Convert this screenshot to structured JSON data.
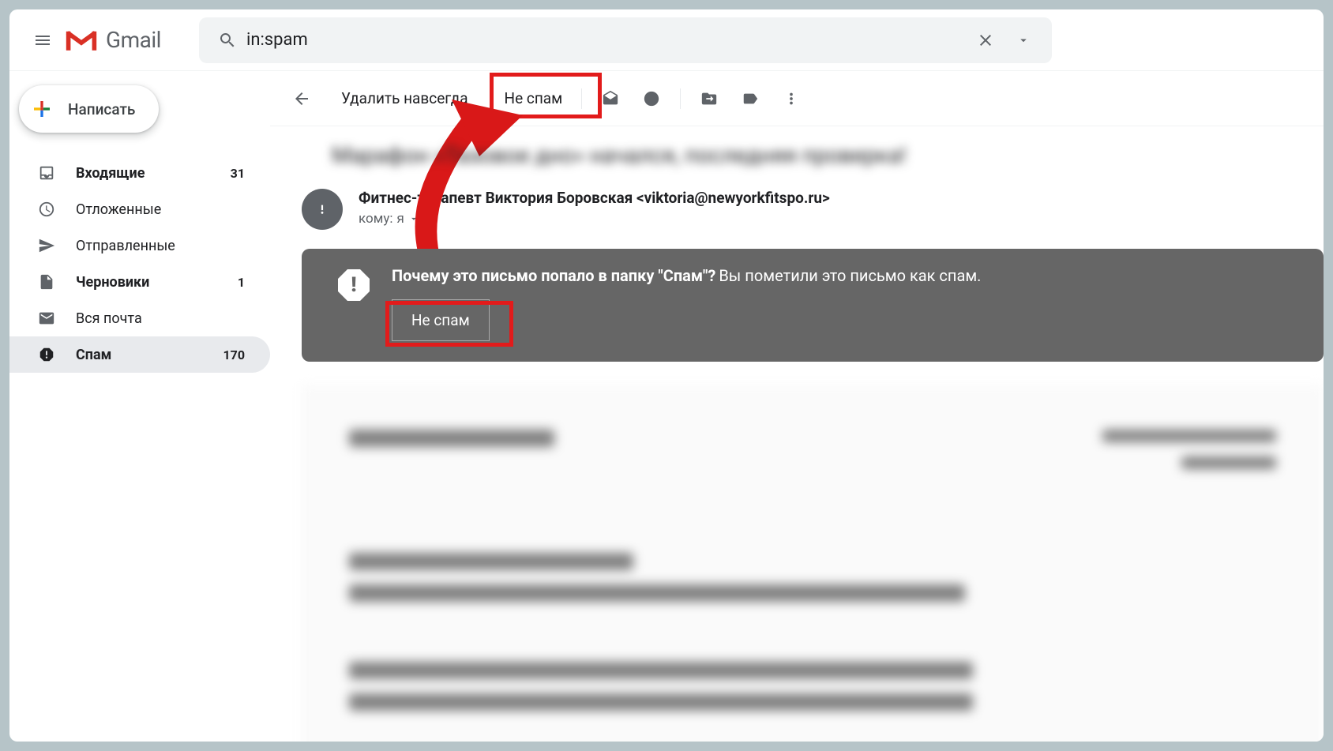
{
  "header": {
    "brand": "Gmail",
    "search_value": "in:spam"
  },
  "sidebar": {
    "compose_label": "Написать",
    "items": [
      {
        "label": "Входящие",
        "count": "31",
        "bold": true,
        "active": false,
        "icon": "inbox"
      },
      {
        "label": "Отложенные",
        "count": "",
        "bold": false,
        "active": false,
        "icon": "snooze"
      },
      {
        "label": "Отправленные",
        "count": "",
        "bold": false,
        "active": false,
        "icon": "sent"
      },
      {
        "label": "Черновики",
        "count": "1",
        "bold": true,
        "active": false,
        "icon": "drafts"
      },
      {
        "label": "Вся почта",
        "count": "",
        "bold": false,
        "active": false,
        "icon": "allmail"
      },
      {
        "label": "Спам",
        "count": "170",
        "bold": true,
        "active": true,
        "icon": "spam"
      }
    ]
  },
  "toolbar": {
    "delete_forever": "Удалить навсегда",
    "not_spam": "Не спам"
  },
  "message": {
    "subject_blurred": "Марафон «Тазовое дно» начался, последняя проверка!",
    "sender": "Фитнес-терапевт Виктория Боровская <viktoria@newyorkfitspo.ru>",
    "recipient_prefix": "кому: ",
    "recipient": "я"
  },
  "spam_banner": {
    "question": "Почему это письмо попало в папку \"Спам\"?",
    "answer": "Вы пометили это письмо как спам.",
    "button": "Не спам"
  }
}
